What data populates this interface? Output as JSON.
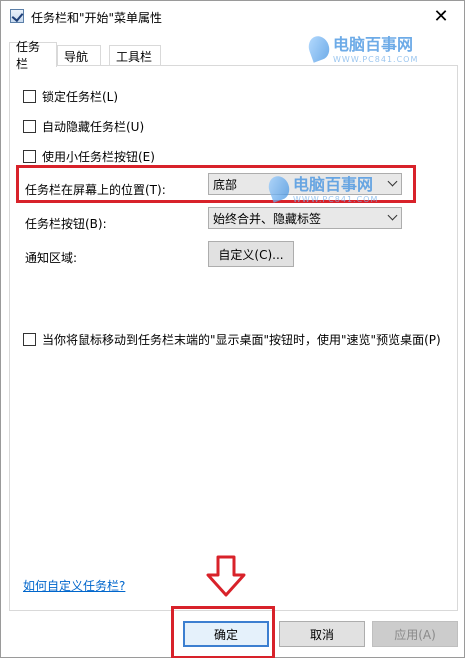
{
  "window": {
    "title": "任务栏和\"开始\"菜单属性",
    "close_glyph": "✕"
  },
  "watermark": {
    "brand": "电脑百事网",
    "site": "WWW.PC841.COM"
  },
  "tabs": [
    {
      "label": "任务栏",
      "active": true
    },
    {
      "label": "导航",
      "active": false
    },
    {
      "label": "工具栏",
      "active": false
    }
  ],
  "options": {
    "lock_taskbar": "锁定任务栏(L)",
    "auto_hide": "自动隐藏任务栏(U)",
    "small_buttons": "使用小任务栏按钮(E)",
    "peek": "当你将鼠标移动到任务栏末端的\"显示桌面\"按钮时，使用\"速览\"预览桌面(P)"
  },
  "position": {
    "label": "任务栏在屏幕上的位置(T):",
    "value": "底部"
  },
  "buttons_setting": {
    "label": "任务栏按钮(B):",
    "value": "始终合并、隐藏标签"
  },
  "notification": {
    "label": "通知区域:",
    "button": "自定义(C)..."
  },
  "help_link": "如何自定义任务栏?",
  "footer": {
    "ok": "确定",
    "cancel": "取消",
    "apply": "应用(A)"
  },
  "colors": {
    "highlight": "#d8222a",
    "link": "#0066cc",
    "focus": "#3c7fd0"
  }
}
